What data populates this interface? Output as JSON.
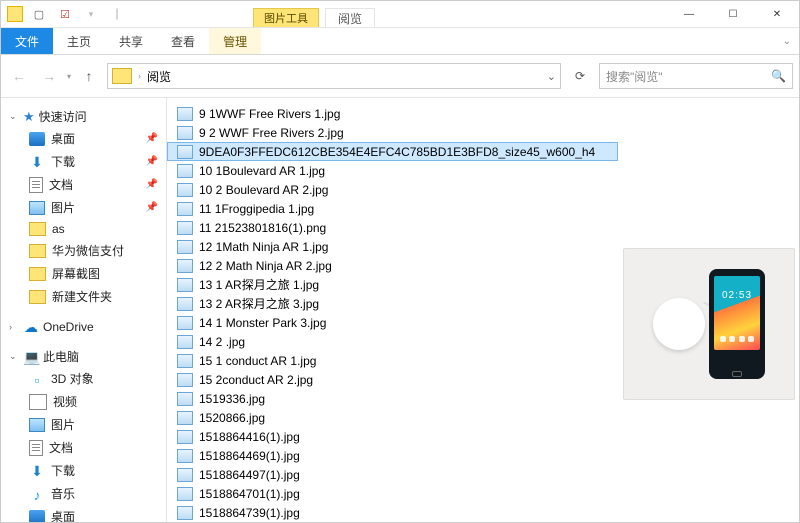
{
  "titlebar": {
    "context_tab_header": "图片工具",
    "context_tab_label": "阅览"
  },
  "ribbon": {
    "file": "文件",
    "tabs": [
      "主页",
      "共享",
      "查看"
    ],
    "context_tab": "管理"
  },
  "address": {
    "crumb": "阅览"
  },
  "search": {
    "placeholder": "搜索\"阅览\""
  },
  "nav": {
    "quick_access": "快速访问",
    "items_qa": [
      {
        "icon": "desktop",
        "label": "桌面",
        "pinned": true
      },
      {
        "icon": "dl",
        "label": "下载",
        "pinned": true
      },
      {
        "icon": "doc",
        "label": "文档",
        "pinned": true
      },
      {
        "icon": "pic",
        "label": "图片",
        "pinned": true
      },
      {
        "icon": "folder",
        "label": "as",
        "pinned": false
      },
      {
        "icon": "folder",
        "label": "华为微信支付",
        "pinned": false
      },
      {
        "icon": "folder",
        "label": "屏幕截图",
        "pinned": false
      },
      {
        "icon": "folder",
        "label": "新建文件夹",
        "pinned": false
      }
    ],
    "onedrive": "OneDrive",
    "this_pc": "此电脑",
    "items_pc": [
      {
        "icon": "cube",
        "label": "3D 对象"
      },
      {
        "icon": "vid",
        "label": "视频"
      },
      {
        "icon": "pic",
        "label": "图片"
      },
      {
        "icon": "doc",
        "label": "文档"
      },
      {
        "icon": "dl",
        "label": "下载"
      },
      {
        "icon": "music",
        "label": "音乐"
      },
      {
        "icon": "desktop",
        "label": "桌面"
      }
    ]
  },
  "files": [
    {
      "name": "9 1WWF Free Rivers 1.jpg",
      "sel": false
    },
    {
      "name": "9 2 WWF Free Rivers  2.jpg",
      "sel": false
    },
    {
      "name": "9DEA0F3FFEDC612CBE354E4EFC4C785BD1E3BFD8_size45_w600_h4",
      "sel": true
    },
    {
      "name": "10 1Boulevard AR 1.jpg",
      "sel": false
    },
    {
      "name": "10 2 Boulevard AR 2.jpg",
      "sel": false
    },
    {
      "name": "11 1Froggipedia 1.jpg",
      "sel": false
    },
    {
      "name": "11 21523801816(1).png",
      "sel": false
    },
    {
      "name": "12 1Math Ninja AR 1.jpg",
      "sel": false
    },
    {
      "name": "12 2 Math Ninja AR 2.jpg",
      "sel": false
    },
    {
      "name": "13 1 AR探月之旅 1.jpg",
      "sel": false
    },
    {
      "name": "13 2 AR探月之旅 3.jpg",
      "sel": false
    },
    {
      "name": "14 1 Monster Park  3.jpg",
      "sel": false
    },
    {
      "name": "14 2 .jpg",
      "sel": false
    },
    {
      "name": "15 1 conduct AR 1.jpg",
      "sel": false
    },
    {
      "name": "15 2conduct AR 2.jpg",
      "sel": false
    },
    {
      "name": "1519336.jpg",
      "sel": false
    },
    {
      "name": "1520866.jpg",
      "sel": false
    },
    {
      "name": "1518864416(1).jpg",
      "sel": false
    },
    {
      "name": "1518864469(1).jpg",
      "sel": false
    },
    {
      "name": "1518864497(1).jpg",
      "sel": false
    },
    {
      "name": "1518864701(1).jpg",
      "sel": false
    },
    {
      "name": "1518864739(1).jpg",
      "sel": false
    }
  ],
  "preview": {
    "clock": "02:53"
  }
}
